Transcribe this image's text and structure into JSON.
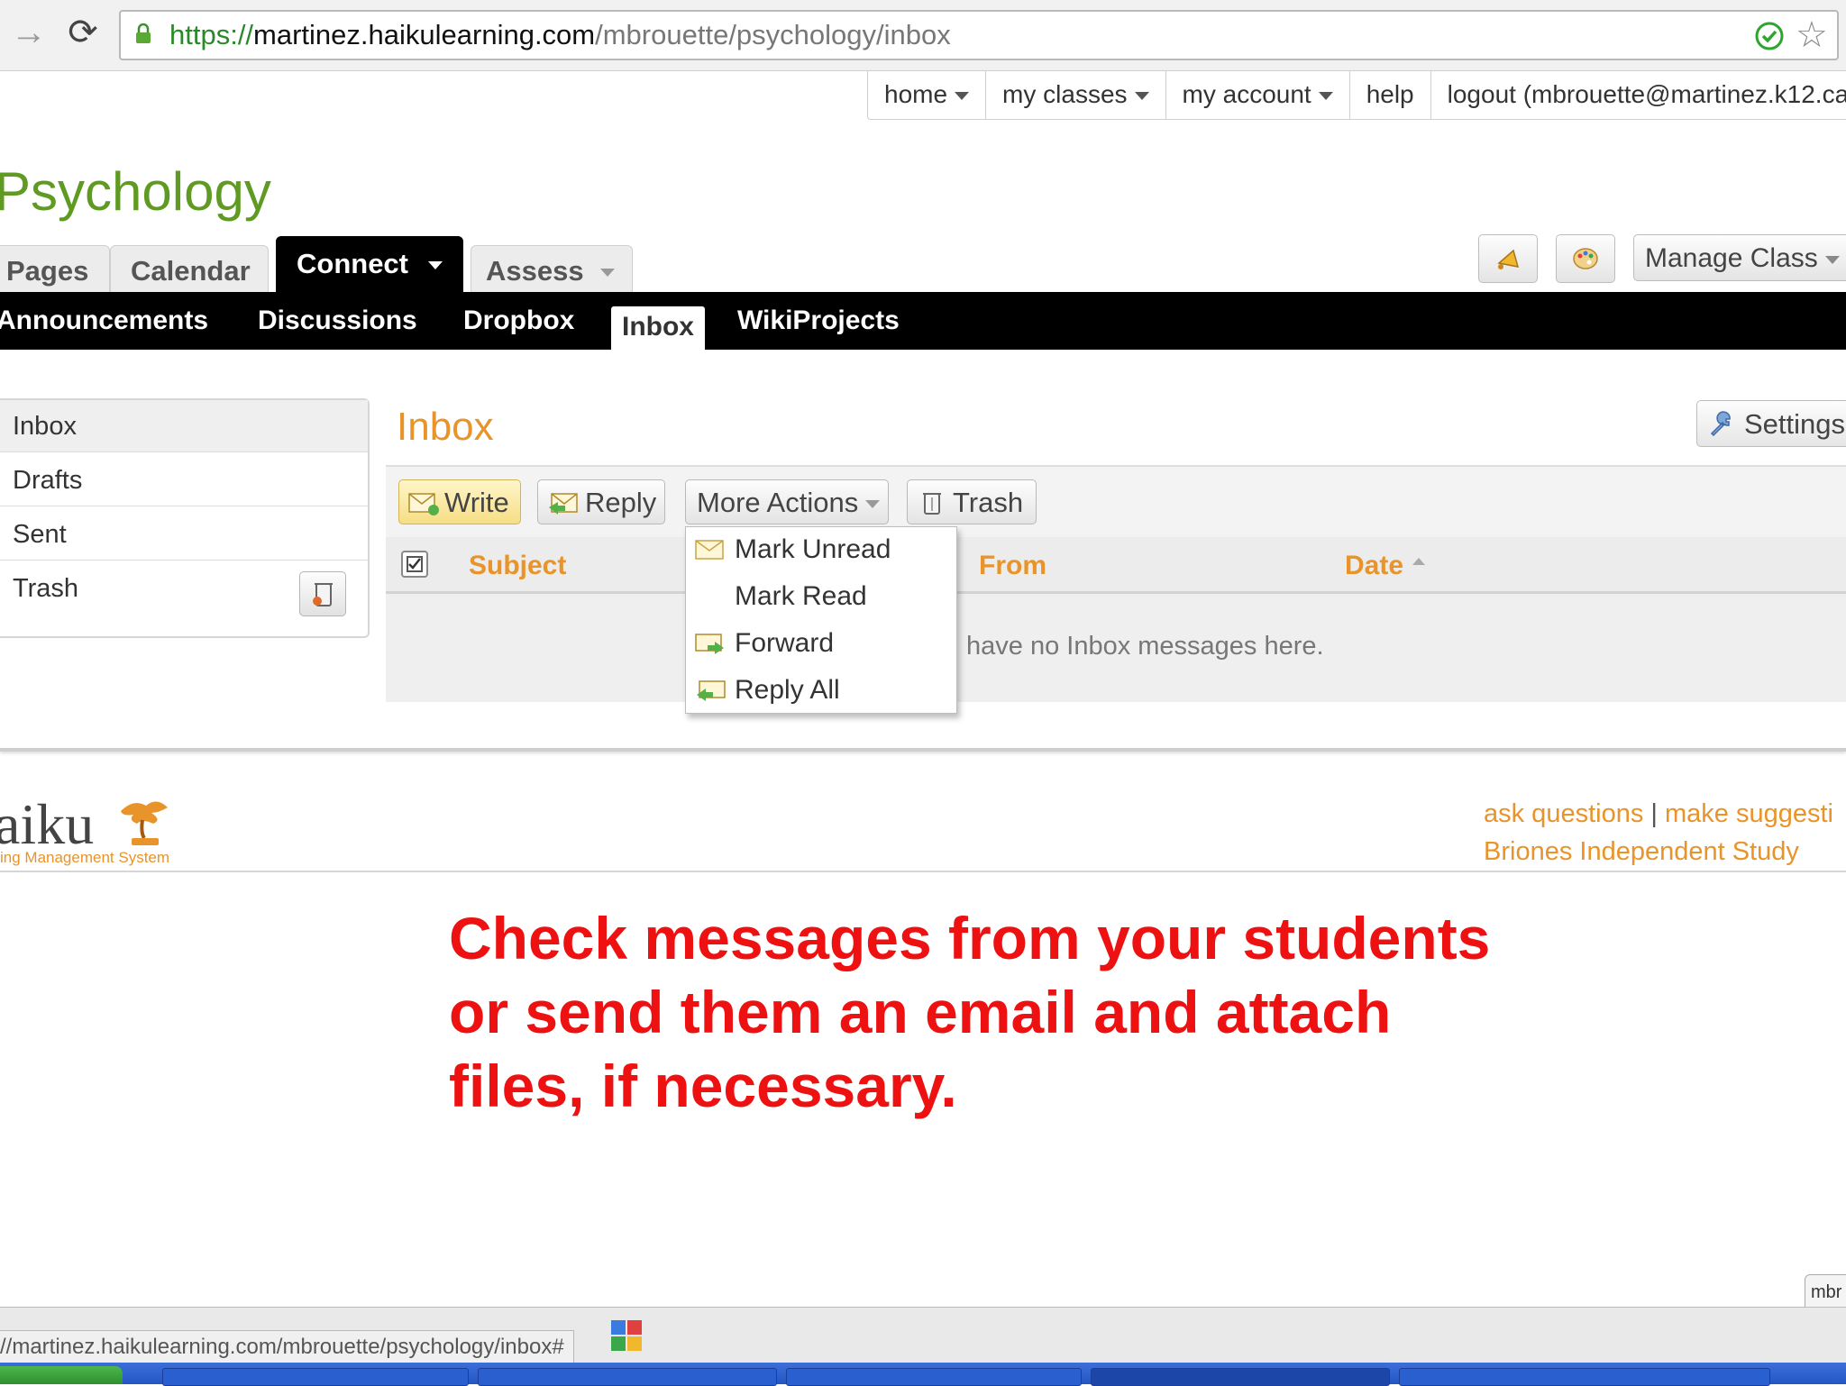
{
  "browser": {
    "url_scheme": "https://",
    "url_host": "martinez.haikulearning.com",
    "url_path": "/mbrouette/psychology/inbox",
    "status_url": "//martinez.haikulearning.com/mbrouette/psychology/inbox#"
  },
  "top_links": [
    "home",
    "my classes",
    "my account",
    "help",
    "logout (mbrouette@martinez.k12.ca.u"
  ],
  "class_title": "Psychology",
  "tabs": [
    "Pages",
    "Calendar",
    "Connect",
    "Assess"
  ],
  "manage_class": "Manage Class",
  "subnav": [
    "Announcements",
    "Discussions",
    "Dropbox",
    "Inbox",
    "WikiProjects"
  ],
  "folders": [
    "Inbox",
    "Drafts",
    "Sent",
    "Trash"
  ],
  "main": {
    "title": "Inbox",
    "settings": "Settings",
    "toolbar": {
      "write": "Write",
      "reply": "Reply",
      "more_actions": "More Actions",
      "trash": "Trash"
    },
    "columns": {
      "subject": "Subject",
      "from": "From",
      "date": "Date"
    },
    "empty_message": "have no Inbox messages here."
  },
  "more_actions_menu": [
    "Mark Unread",
    "Mark Read",
    "Forward",
    "Reply All"
  ],
  "footer": {
    "logo": "aiku",
    "tagline": "ing Management System",
    "ask": "ask questions",
    "separator": "|",
    "suggest": "make suggesti",
    "school": "Briones Independent Study"
  },
  "caption": "Check messages from your students or send them an email and attach files, if necessary.",
  "mini_tab": "mbr",
  "colors": {
    "accent_orange": "#e8942a",
    "title_green": "#5f9a22",
    "caption_red": "#ee1111"
  },
  "icons": [
    "forward-arrow-icon",
    "reload-icon",
    "lock-icon",
    "verified-icon",
    "star-icon",
    "announce-icon",
    "palette-icon",
    "wrench-icon",
    "envelope-icon",
    "trash-can-icon",
    "select-all-icon",
    "sort-asc-icon"
  ]
}
